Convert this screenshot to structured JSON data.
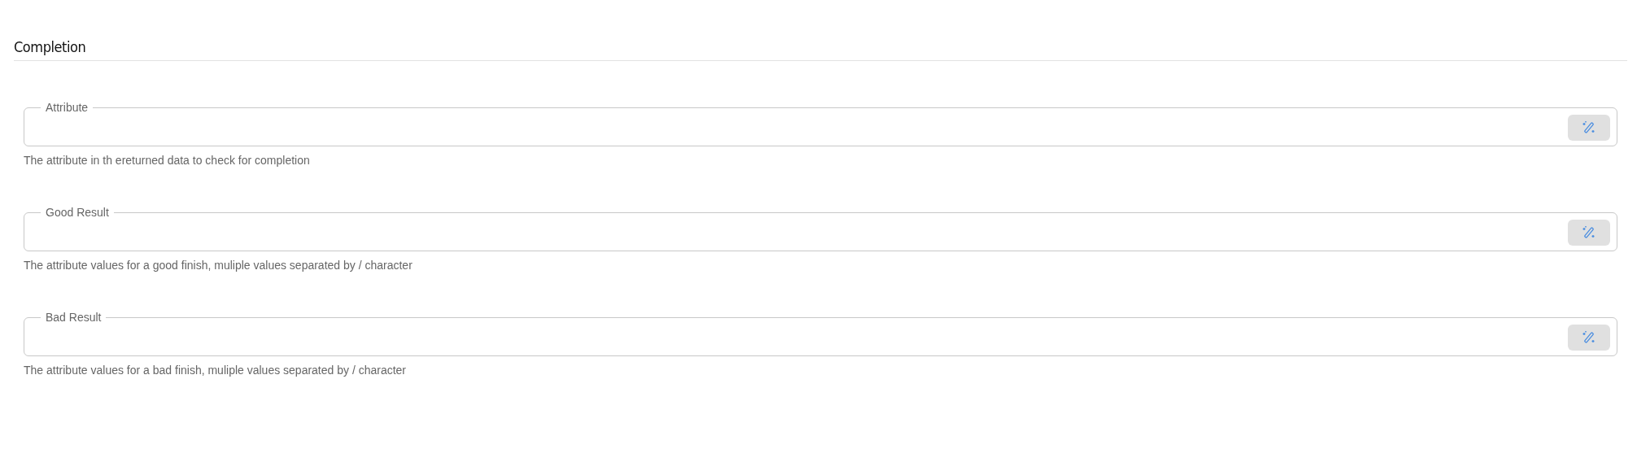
{
  "section": {
    "title": "Completion"
  },
  "fields": [
    {
      "label": "Attribute",
      "helper": "The attribute in th ereturned data to check for completion"
    },
    {
      "label": "Good Result",
      "helper": "The attribute values for a good finish, muliple values separated by / character"
    },
    {
      "label": "Bad Result",
      "helper": "The attribute values for a bad finish, muliple values separated by / character"
    }
  ]
}
